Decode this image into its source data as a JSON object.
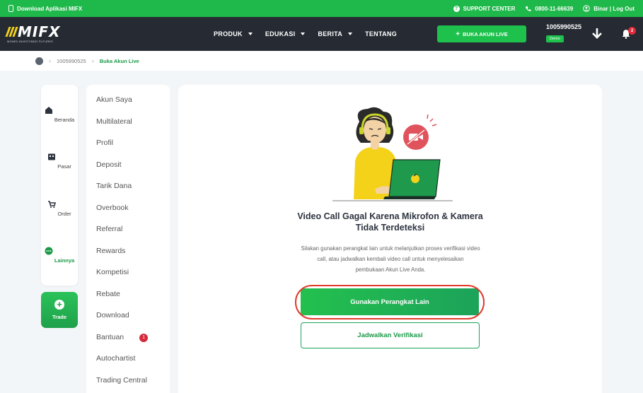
{
  "topbar": {
    "download_label": "Download Aplikasi MIFX",
    "support_label": "SUPPORT CENTER",
    "phone_label": "0800-11-66639",
    "user_label": "Binar | Log Out"
  },
  "navbar": {
    "logo_text": "MIFX",
    "logo_sub": "MONEX INVESTINDO FUTURES",
    "menu": [
      {
        "label": "PRODUK"
      },
      {
        "label": "EDUKASI"
      },
      {
        "label": "BERITA"
      },
      {
        "label": "TENTANG"
      }
    ],
    "open_live_label": "BUKA AKUN LIVE",
    "account_number": "1005990525",
    "account_type": "Demo",
    "notification_count": "2"
  },
  "breadcrumb": {
    "account": "1005990525",
    "current": "Buka Akun Live"
  },
  "rail": {
    "items": [
      {
        "label": "Beranda",
        "icon": "home-icon"
      },
      {
        "label": "Pasar",
        "icon": "market-icon"
      },
      {
        "label": "Order",
        "icon": "cart-icon"
      },
      {
        "label": "Lainnya",
        "icon": "more-icon"
      }
    ],
    "trade_label": "Trade"
  },
  "side_menu": {
    "items": [
      {
        "label": "Akun Saya"
      },
      {
        "label": "Multilateral"
      },
      {
        "label": "Profil"
      },
      {
        "label": "Deposit"
      },
      {
        "label": "Tarik Dana"
      },
      {
        "label": "Overbook"
      },
      {
        "label": "Referral"
      },
      {
        "label": "Rewards"
      },
      {
        "label": "Kompetisi"
      },
      {
        "label": "Rebate"
      },
      {
        "label": "Download"
      },
      {
        "label": "Bantuan",
        "badge": "1"
      },
      {
        "label": "Autochartist"
      },
      {
        "label": "Trading Central"
      }
    ]
  },
  "main": {
    "heading_line1": "Video Call Gagal Karena Mikrofon & Kamera",
    "heading_line2": "Tidak Terdeteksi",
    "desc_line1": "Silakan gunakan perangkat lain untuk melanjutkan proses verifikasi video",
    "desc_line2": "call, atau jadwalkan kembali video call untuk menyelesaikan",
    "desc_line3": "pembukaan Akun Live Anda.",
    "primary_button": "Gunakan Perangkat Lain",
    "secondary_button": "Jadwalkan Verifikasi"
  },
  "colors": {
    "brand_green": "#1fb84a",
    "nav_dark": "#262b33",
    "highlight_red": "#e03a2a",
    "logo_yellow": "#f5d21a"
  }
}
